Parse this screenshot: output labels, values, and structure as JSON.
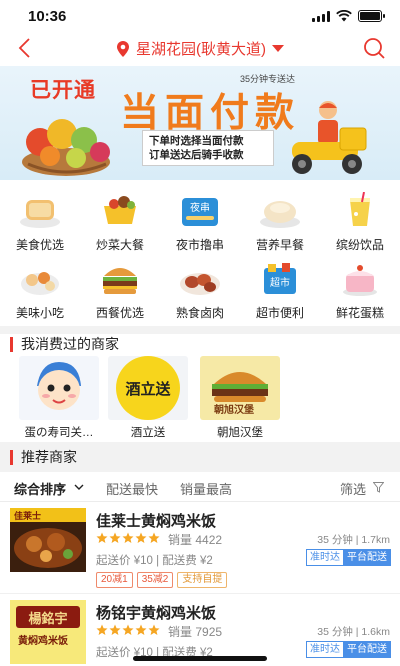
{
  "status": {
    "time": "10:36"
  },
  "nav": {
    "location": "星湖花园(耿黄大道)"
  },
  "banner": {
    "opened": "已开通",
    "title": "当面付款",
    "subtitle": "35分钟专送达",
    "note_line1": "下单时选择当面付款",
    "note_line2": "订单送达后骑手收款"
  },
  "categories": [
    {
      "label": "美食优选",
      "icon": "toast-icon"
    },
    {
      "label": "炒菜大餐",
      "icon": "stir-fry-icon"
    },
    {
      "label": "夜市撸串",
      "icon": "night-market-icon",
      "tag": "夜串"
    },
    {
      "label": "营养早餐",
      "icon": "breakfast-icon"
    },
    {
      "label": "缤纷饮品",
      "icon": "drink-icon"
    },
    {
      "label": "美味小吃",
      "icon": "snack-icon"
    },
    {
      "label": "西餐优选",
      "icon": "burger-icon"
    },
    {
      "label": "熟食卤肉",
      "icon": "braised-meat-icon"
    },
    {
      "label": "超市便利",
      "icon": "supermarket-icon",
      "tag": "超市"
    },
    {
      "label": "鲜花蛋糕",
      "icon": "cake-icon"
    }
  ],
  "consumed": {
    "title": "我消费过的商家",
    "merchants": [
      {
        "name": "蛋の寿司关…"
      },
      {
        "name": "酒立送",
        "logo_text": "酒立送"
      },
      {
        "name": "朝旭汉堡",
        "logo_text": "朝旭汉堡"
      }
    ]
  },
  "recommend": {
    "title": "推荐商家",
    "sort": {
      "default": "综合排序",
      "fastest": "配送最快",
      "sales": "销量最高",
      "filter": "筛选"
    },
    "stores": [
      {
        "name": "佳莱士黄焖鸡米饭",
        "rating": 5,
        "sales_label": "销量",
        "sales": "4422",
        "min_order": "起送价 ¥10 | 配送费 ¥2",
        "time_dist": "35 分钟 | 1.7km",
        "badge_ontime": "准时达",
        "badge_platform": "平台配送",
        "promos": [
          "20减1",
          "35减2",
          "支持自提"
        ],
        "logo_text": "佳莱士"
      },
      {
        "name": "杨铭宇黄焖鸡米饭",
        "rating": 5,
        "sales_label": "销量",
        "sales": "7925",
        "min_order": "起送价 ¥10 | 配送费 ¥2",
        "time_dist": "35 分钟 | 1.6km",
        "badge_ontime": "准时达",
        "badge_platform": "平台配送",
        "logo_text": "楊銘宇",
        "logo_sub": "黄焖鸡米饭"
      }
    ]
  },
  "colors": {
    "accent": "#e8382f",
    "blue": "#4a8fe7",
    "star": "#f5a623",
    "orange": "#f07b1c"
  }
}
